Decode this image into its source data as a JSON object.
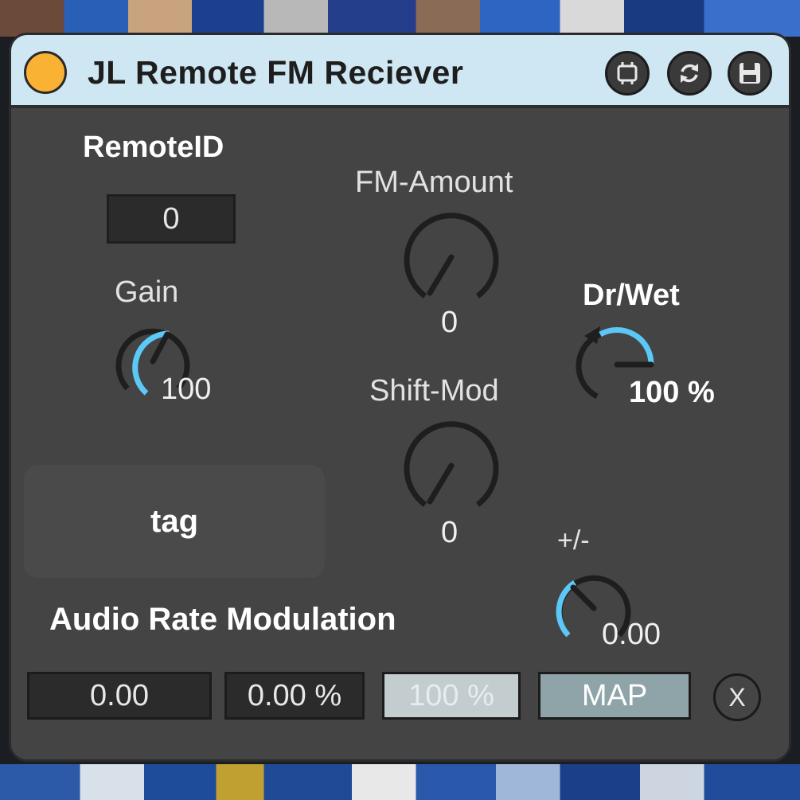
{
  "device": {
    "title": "JL Remote FM Reciever",
    "led_color": "#f9b233",
    "title_bar_color": "#cfe6f3",
    "buttons": [
      "freeze-icon",
      "refresh-icon",
      "save-icon"
    ]
  },
  "remote_id": {
    "label": "RemoteID",
    "value": "0"
  },
  "gain": {
    "label": "Gain",
    "value": "100",
    "level": 1.0
  },
  "fm_amount": {
    "label": "FM-Amount",
    "value": "0",
    "level": 0.0
  },
  "dry_wet": {
    "label": "Dr/Wet",
    "value": "100 %",
    "level": 1.0
  },
  "shift_mod": {
    "label": "Shift-Mod",
    "value": "0",
    "level": 0.0
  },
  "plus_minus": {
    "label": "+/-",
    "value": "0.00",
    "level": 0.5
  },
  "tag": {
    "label": "tag"
  },
  "audio_rate": {
    "label": "Audio Rate Modulation"
  },
  "bottom": {
    "value": "0.00",
    "percent": "0.00 %",
    "depth": "100 %",
    "map_label": "MAP",
    "close_label": "X"
  },
  "colors": {
    "accent": "#5bc8f5",
    "panel": "#444444"
  }
}
